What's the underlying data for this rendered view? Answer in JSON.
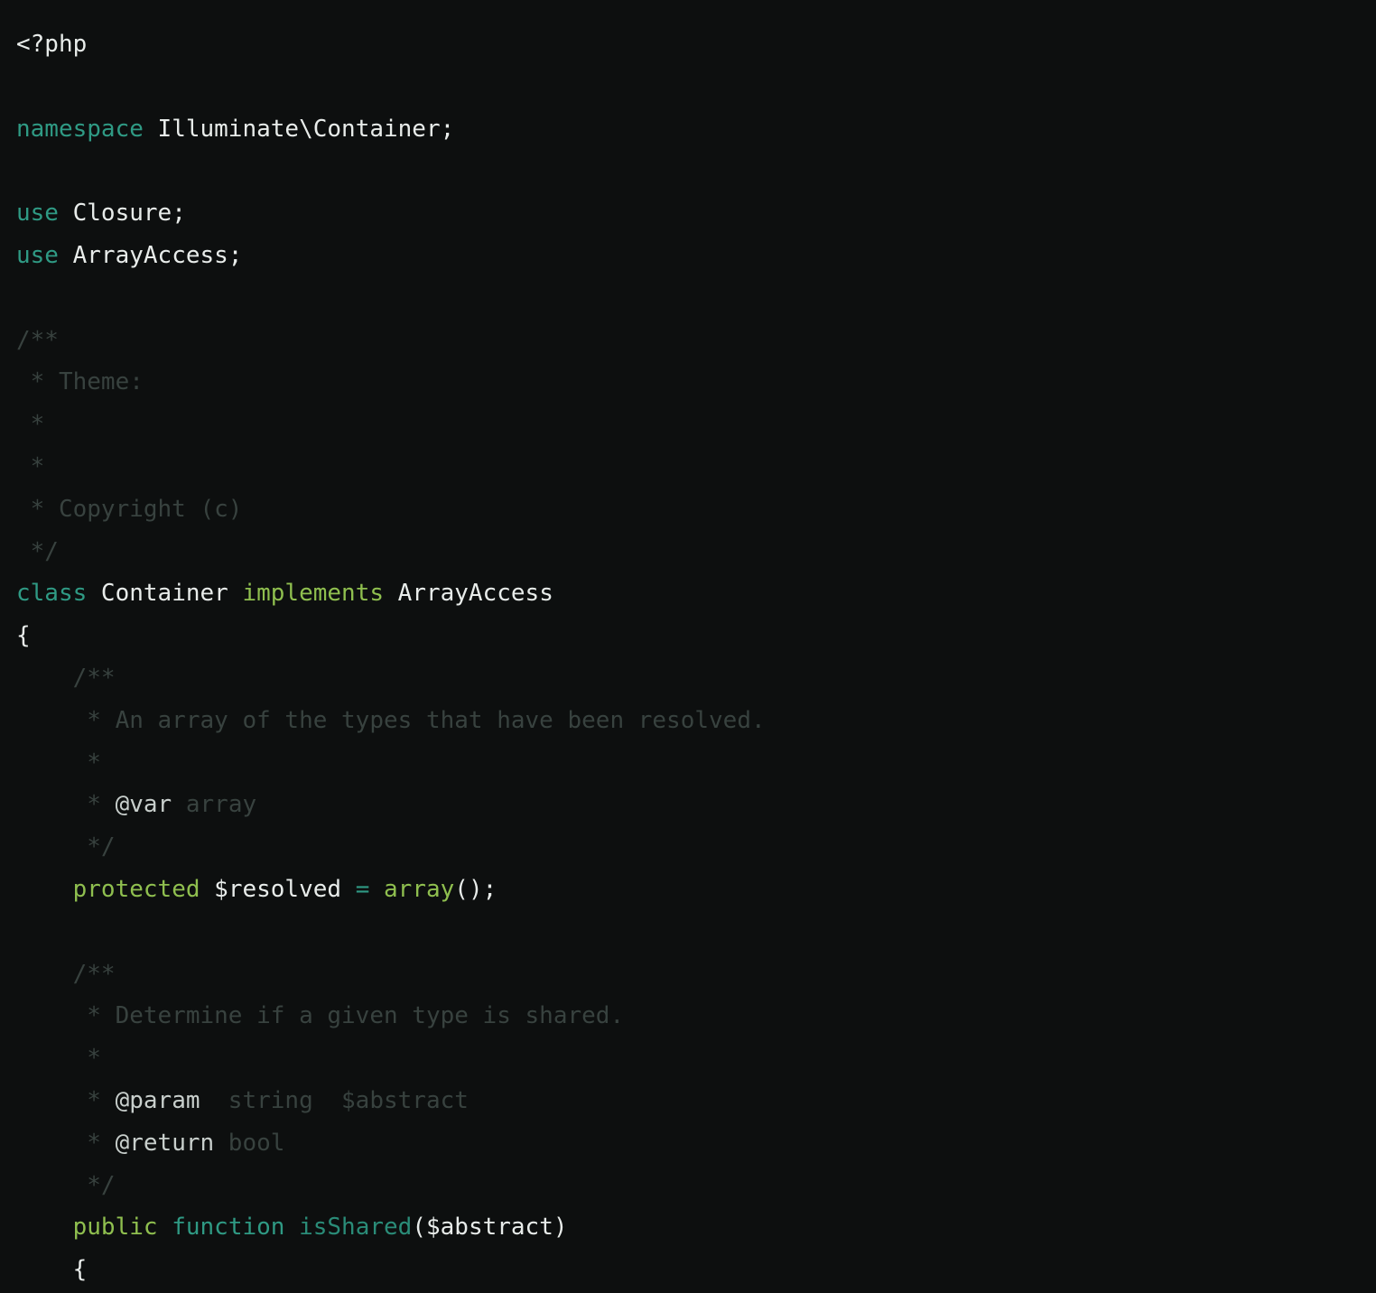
{
  "editor": {
    "language": "php",
    "colors": {
      "background": "#0d0f0f",
      "default": "#e8ecea",
      "keyword": "#2f9a84",
      "keyword2": "#8fbf4f",
      "comment": "#38423f",
      "doc_tag": "#c8cfcc",
      "function": "#2a8c78"
    },
    "lines": [
      [
        {
          "t": "<?php",
          "k": "default"
        }
      ],
      [],
      [
        {
          "t": "namespace",
          "k": "keyword"
        },
        {
          "t": " Illuminate\\Container;",
          "k": "default"
        }
      ],
      [],
      [
        {
          "t": "use",
          "k": "keyword"
        },
        {
          "t": " Closure;",
          "k": "default"
        }
      ],
      [
        {
          "t": "use",
          "k": "keyword"
        },
        {
          "t": " ArrayAccess;",
          "k": "default"
        }
      ],
      [],
      [
        {
          "t": "/**",
          "k": "comment"
        }
      ],
      [
        {
          "t": " * Theme:",
          "k": "comment"
        }
      ],
      [
        {
          "t": " *",
          "k": "comment"
        }
      ],
      [
        {
          "t": " *",
          "k": "comment"
        }
      ],
      [
        {
          "t": " * Copyright (c)",
          "k": "comment"
        }
      ],
      [
        {
          "t": " */",
          "k": "comment"
        }
      ],
      [
        {
          "t": "class",
          "k": "keyword"
        },
        {
          "t": " Container ",
          "k": "default"
        },
        {
          "t": "implements",
          "k": "keyword2"
        },
        {
          "t": " ArrayAccess",
          "k": "default"
        }
      ],
      [
        {
          "t": "{",
          "k": "default"
        }
      ],
      [
        {
          "t": "    /**",
          "k": "comment"
        }
      ],
      [
        {
          "t": "     * An array of the types that have been resolved.",
          "k": "comment"
        }
      ],
      [
        {
          "t": "     *",
          "k": "comment"
        }
      ],
      [
        {
          "t": "     * ",
          "k": "comment"
        },
        {
          "t": "@var",
          "k": "tag"
        },
        {
          "t": " array",
          "k": "comment"
        }
      ],
      [
        {
          "t": "     */",
          "k": "comment"
        }
      ],
      [
        {
          "t": "    ",
          "k": "default"
        },
        {
          "t": "protected",
          "k": "keyword2"
        },
        {
          "t": " $resolved ",
          "k": "default"
        },
        {
          "t": "=",
          "k": "op"
        },
        {
          "t": " ",
          "k": "default"
        },
        {
          "t": "array",
          "k": "keyword2"
        },
        {
          "t": "();",
          "k": "default"
        }
      ],
      [],
      [
        {
          "t": "    /**",
          "k": "comment"
        }
      ],
      [
        {
          "t": "     * Determine if a given type is shared.",
          "k": "comment"
        }
      ],
      [
        {
          "t": "     *",
          "k": "comment"
        }
      ],
      [
        {
          "t": "     * ",
          "k": "comment"
        },
        {
          "t": "@param",
          "k": "tag"
        },
        {
          "t": "  string  $abstract",
          "k": "comment"
        }
      ],
      [
        {
          "t": "     * ",
          "k": "comment"
        },
        {
          "t": "@return",
          "k": "tag"
        },
        {
          "t": " bool",
          "k": "comment"
        }
      ],
      [
        {
          "t": "     */",
          "k": "comment"
        }
      ],
      [
        {
          "t": "    ",
          "k": "default"
        },
        {
          "t": "public",
          "k": "keyword2"
        },
        {
          "t": " ",
          "k": "default"
        },
        {
          "t": "function",
          "k": "keyword"
        },
        {
          "t": " ",
          "k": "default"
        },
        {
          "t": "isShared",
          "k": "func"
        },
        {
          "t": "($abstract)",
          "k": "default"
        }
      ],
      [
        {
          "t": "    {",
          "k": "default"
        }
      ]
    ]
  }
}
